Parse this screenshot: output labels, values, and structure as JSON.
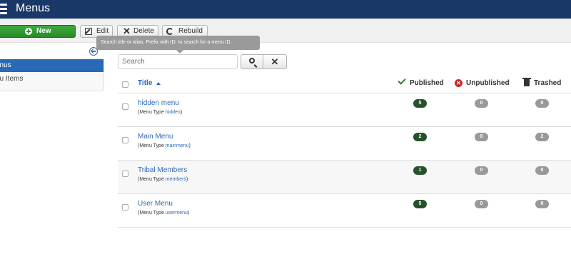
{
  "header": {
    "title": "Menus"
  },
  "toolbar": {
    "new_label": "New",
    "edit_label": "Edit",
    "delete_label": "Delete",
    "rebuild_label": "Rebuild"
  },
  "tooltip": {
    "text": "Search title or alias. Prefix with ID: to search for a menu ID."
  },
  "sidebar": {
    "items": [
      {
        "label": "enus",
        "active": true
      },
      {
        "label": "nu Items",
        "active": false
      }
    ]
  },
  "search": {
    "placeholder": "Search",
    "value": ""
  },
  "table": {
    "headers": {
      "title": "Title",
      "published": "Published",
      "unpublished": "Unpublished",
      "trashed": "Trashed"
    },
    "menu_type_prefix": "(Menu Type ",
    "menu_type_suffix": ")",
    "rows": [
      {
        "title": "hidden menu",
        "menu_type": "hidden",
        "published": "5",
        "unpublished": "0",
        "trashed": "0"
      },
      {
        "title": "Main Menu",
        "menu_type": "mainmenu",
        "published": "2",
        "unpublished": "0",
        "trashed": "2"
      },
      {
        "title": "Tribal Members",
        "menu_type": "members",
        "published": "1",
        "unpublished": "0",
        "trashed": "0"
      },
      {
        "title": "User Menu",
        "menu_type": "usermenu",
        "published": "5",
        "unpublished": "0",
        "trashed": "0"
      }
    ]
  },
  "colors": {
    "header_bg": "#1a3867",
    "new_button": "#2f962f",
    "active_sidebar": "#2a69b8",
    "published_badge": "#25522a",
    "zero_badge": "#999999"
  }
}
